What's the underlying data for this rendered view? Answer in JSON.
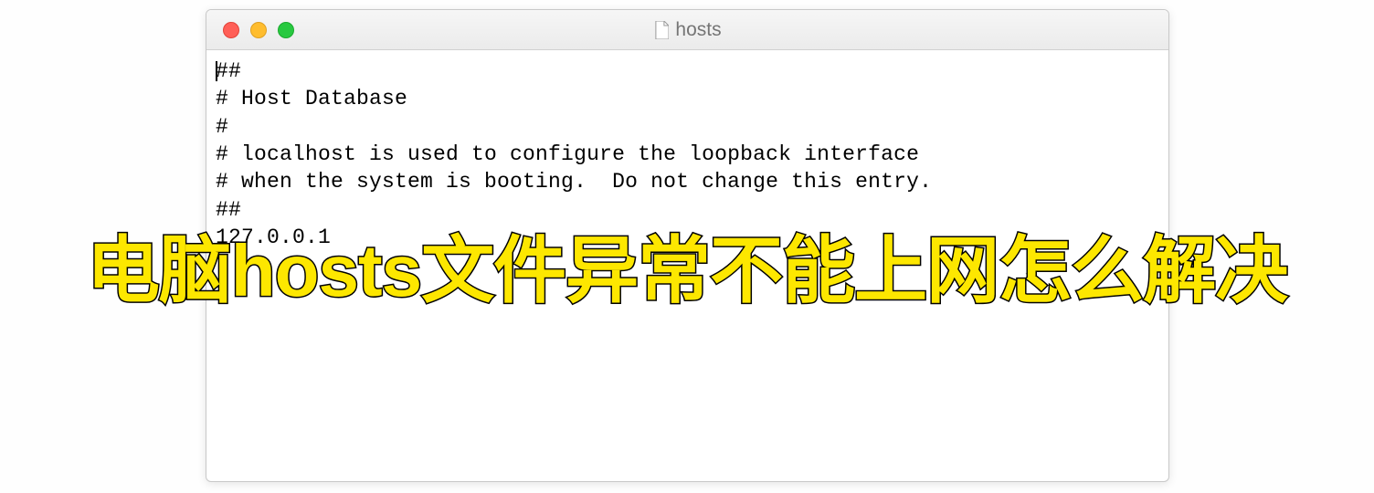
{
  "window": {
    "title": "hosts",
    "content": {
      "line1": "##",
      "line2": "# Host Database",
      "line3": "#",
      "line4": "# localhost is used to configure the loopback interface",
      "line5": "# when the system is booting.  Do not change this entry.",
      "line6": "##",
      "line7": "127.0.0.1"
    }
  },
  "overlay": {
    "text": "电脑hosts文件异常不能上网怎么解决"
  }
}
